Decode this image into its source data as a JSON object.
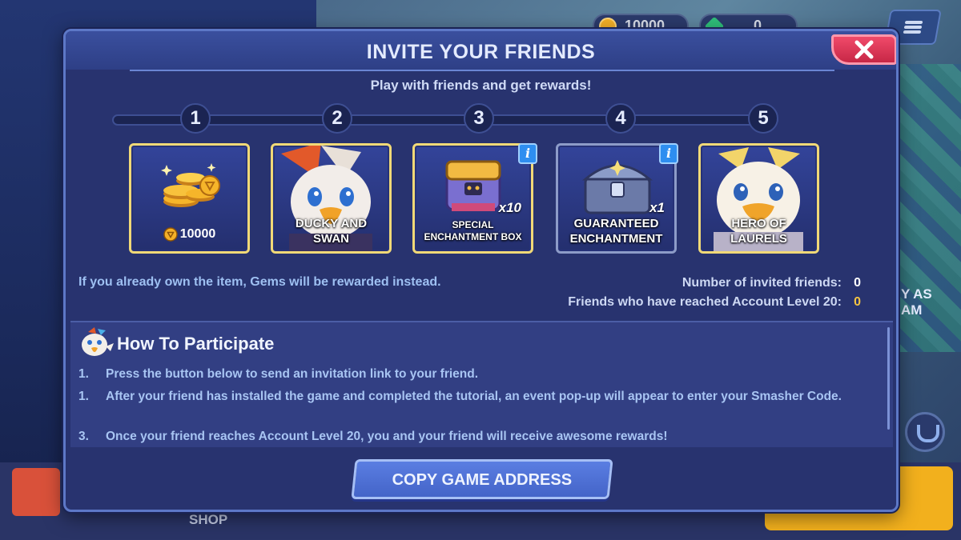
{
  "background": {
    "currency": [
      {
        "value": "10000",
        "icon": "gold-coin-icon",
        "color": "#f4b028"
      },
      {
        "value": "0",
        "icon": "green-gem-icon",
        "color": "#2fbf7a"
      }
    ],
    "side_label": "Y AS\nAM",
    "shop_label": "SHOP"
  },
  "modal": {
    "title": "INVITE YOUR FRIENDS",
    "subtitle": "Play with friends and get rewards!",
    "close_label": "X"
  },
  "steps": [
    "1",
    "2",
    "3",
    "4",
    "5"
  ],
  "rewards": [
    {
      "label": "10000",
      "type": "coins",
      "border": "#f1d977"
    },
    {
      "label": "DUCKY AND\nSWAN",
      "type": "character",
      "border": "#f1d977"
    },
    {
      "label": "SPECIAL\nENCHANTMENT BOX",
      "type": "box",
      "quantity": "x10",
      "info": "i",
      "border": "#f1d977"
    },
    {
      "label": "GUARANTEED\nENCHANTMENT",
      "type": "chest",
      "quantity": "x1",
      "info": "i",
      "border": "#8d9cc8"
    },
    {
      "label": "HERO OF\nLAURELS",
      "type": "character",
      "border": "#f1d977"
    }
  ],
  "note": "If you already own the item, Gems will be rewarded instead.",
  "stats": [
    {
      "label": "Number of invited friends:",
      "value": "0"
    },
    {
      "label": "Friends who have reached Account Level 20:",
      "value": "0"
    }
  ],
  "howto": {
    "title": "How To Participate",
    "items": [
      {
        "num": "1.",
        "text": "Press the button below to send an invitation link to your friend."
      },
      {
        "num": "1.",
        "text": "After your friend has installed the game and completed the tutorial, an event pop-up will appear to enter your Smasher Code."
      },
      {
        "num": "3.",
        "text": "Once your friend reaches Account Level 20, you and your friend will receive awesome rewards!"
      }
    ]
  },
  "copy_button": "COPY GAME ADDRESS"
}
